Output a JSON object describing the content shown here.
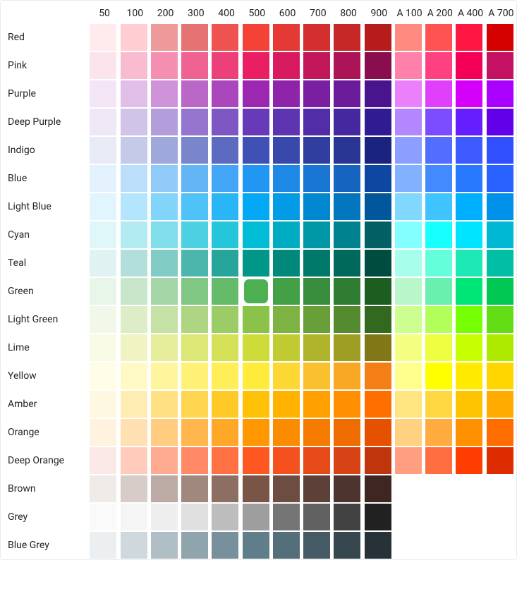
{
  "column_labels": [
    "50",
    "100",
    "200",
    "300",
    "400",
    "500",
    "600",
    "700",
    "800",
    "900",
    "A 100",
    "A 200",
    "A 400",
    "A 700"
  ],
  "row_labels": [
    "Red",
    "Pink",
    "Purple",
    "Deep Purple",
    "Indigo",
    "Blue",
    "Light Blue",
    "Cyan",
    "Teal",
    "Green",
    "Light Green",
    "Lime",
    "Yellow",
    "Amber",
    "Orange",
    "Deep Orange",
    "Brown",
    "Grey",
    "Blue Grey"
  ],
  "selected": {
    "row": 9,
    "col": 5
  },
  "palette": {
    "Red": {
      "50": "#ffebee",
      "100": "#ffcdd2",
      "200": "#ef9a9a",
      "300": "#e57373",
      "400": "#ef5350",
      "500": "#f44336",
      "600": "#e53935",
      "700": "#d32f2f",
      "800": "#c62828",
      "900": "#b71c1c",
      "A 100": "#ff8a80",
      "A 200": "#ff5252",
      "A 400": "#ff1744",
      "A 700": "#d50000"
    },
    "Pink": {
      "50": "#fce4ec",
      "100": "#f8bbd0",
      "200": "#f48fb1",
      "300": "#f06292",
      "400": "#ec407a",
      "500": "#e91e63",
      "600": "#d81b60",
      "700": "#c2185b",
      "800": "#ad1457",
      "900": "#880e4f",
      "A 100": "#ff80ab",
      "A 200": "#ff4081",
      "A 400": "#f50057",
      "A 700": "#c51162"
    },
    "Purple": {
      "50": "#f3e5f5",
      "100": "#e1bee7",
      "200": "#ce93d8",
      "300": "#ba68c8",
      "400": "#ab47bc",
      "500": "#9c27b0",
      "600": "#8e24aa",
      "700": "#7b1fa2",
      "800": "#6a1b9a",
      "900": "#4a148c",
      "A 100": "#ea80fc",
      "A 200": "#e040fb",
      "A 400": "#d500f9",
      "A 700": "#aa00ff"
    },
    "Deep Purple": {
      "50": "#ede7f6",
      "100": "#d1c4e9",
      "200": "#b39ddb",
      "300": "#9575cd",
      "400": "#7e57c2",
      "500": "#673ab7",
      "600": "#5e35b1",
      "700": "#512da8",
      "800": "#4527a0",
      "900": "#311b92",
      "A 100": "#b388ff",
      "A 200": "#7c4dff",
      "A 400": "#651fff",
      "A 700": "#6200ea"
    },
    "Indigo": {
      "50": "#e8eaf6",
      "100": "#c5cae9",
      "200": "#9fa8da",
      "300": "#7986cb",
      "400": "#5c6bc0",
      "500": "#3f51b5",
      "600": "#3949ab",
      "700": "#303f9f",
      "800": "#283593",
      "900": "#1a237e",
      "A 100": "#8c9eff",
      "A 200": "#536dfe",
      "A 400": "#3d5afe",
      "A 700": "#304ffe"
    },
    "Blue": {
      "50": "#e3f2fd",
      "100": "#bbdefb",
      "200": "#90caf9",
      "300": "#64b5f6",
      "400": "#42a5f5",
      "500": "#2196f3",
      "600": "#1e88e5",
      "700": "#1976d2",
      "800": "#1565c0",
      "900": "#0d47a1",
      "A 100": "#82b1ff",
      "A 200": "#448aff",
      "A 400": "#2979ff",
      "A 700": "#2962ff"
    },
    "Light Blue": {
      "50": "#e1f5fe",
      "100": "#b3e5fc",
      "200": "#81d4fa",
      "300": "#4fc3f7",
      "400": "#29b6f6",
      "500": "#03a9f4",
      "600": "#039be5",
      "700": "#0288d1",
      "800": "#0277bd",
      "900": "#01579b",
      "A 100": "#80d8ff",
      "A 200": "#40c4ff",
      "A 400": "#00b0ff",
      "A 700": "#0091ea"
    },
    "Cyan": {
      "50": "#e0f7fa",
      "100": "#b2ebf2",
      "200": "#80deea",
      "300": "#4dd0e1",
      "400": "#26c6da",
      "500": "#00bcd4",
      "600": "#00acc1",
      "700": "#0097a7",
      "800": "#00838f",
      "900": "#006064",
      "A 100": "#84ffff",
      "A 200": "#18ffff",
      "A 400": "#00e5ff",
      "A 700": "#00b8d4"
    },
    "Teal": {
      "50": "#e0f2f1",
      "100": "#b2dfdb",
      "200": "#80cbc4",
      "300": "#4db6ac",
      "400": "#26a69a",
      "500": "#009688",
      "600": "#00897b",
      "700": "#00796b",
      "800": "#00695c",
      "900": "#004d40",
      "A 100": "#a7ffeb",
      "A 200": "#64ffda",
      "A 400": "#1de9b6",
      "A 700": "#00bfa5"
    },
    "Green": {
      "50": "#e8f5e9",
      "100": "#c8e6c9",
      "200": "#a5d6a7",
      "300": "#81c784",
      "400": "#66bb6a",
      "500": "#4caf50",
      "600": "#43a047",
      "700": "#388e3c",
      "800": "#2e7d32",
      "900": "#1b5e20",
      "A 100": "#b9f6ca",
      "A 200": "#69f0ae",
      "A 400": "#00e676",
      "A 700": "#00c853"
    },
    "Light Green": {
      "50": "#f1f8e9",
      "100": "#dcedc8",
      "200": "#c5e1a5",
      "300": "#aed581",
      "400": "#9ccc65",
      "500": "#8bc34a",
      "600": "#7cb342",
      "700": "#689f38",
      "800": "#558b2f",
      "900": "#33691e",
      "A 100": "#ccff90",
      "A 200": "#b2ff59",
      "A 400": "#76ff03",
      "A 700": "#64dd17"
    },
    "Lime": {
      "50": "#f9fbe7",
      "100": "#f0f4c3",
      "200": "#e6ee9c",
      "300": "#dce775",
      "400": "#d4e157",
      "500": "#cddc39",
      "600": "#c0ca33",
      "700": "#afb42b",
      "800": "#9e9d24",
      "900": "#827717",
      "A 100": "#f4ff81",
      "A 200": "#eeff41",
      "A 400": "#c6ff00",
      "A 700": "#aeea00"
    },
    "Yellow": {
      "50": "#fffde7",
      "100": "#fff9c4",
      "200": "#fff59d",
      "300": "#fff176",
      "400": "#ffee58",
      "500": "#ffeb3b",
      "600": "#fdd835",
      "700": "#fbc02d",
      "800": "#f9a825",
      "900": "#f57f17",
      "A 100": "#ffff8d",
      "A 200": "#ffff00",
      "A 400": "#ffea00",
      "A 700": "#ffd600"
    },
    "Amber": {
      "50": "#fff8e1",
      "100": "#ffecb3",
      "200": "#ffe082",
      "300": "#ffd54f",
      "400": "#ffca28",
      "500": "#ffc107",
      "600": "#ffb300",
      "700": "#ffa000",
      "800": "#ff8f00",
      "900": "#ff6f00",
      "A 100": "#ffe57f",
      "A 200": "#ffd740",
      "A 400": "#ffc400",
      "A 700": "#ffab00"
    },
    "Orange": {
      "50": "#fff3e0",
      "100": "#ffe0b2",
      "200": "#ffcc80",
      "300": "#ffb74d",
      "400": "#ffa726",
      "500": "#ff9800",
      "600": "#fb8c00",
      "700": "#f57c00",
      "800": "#ef6c00",
      "900": "#e65100",
      "A 100": "#ffd180",
      "A 200": "#ffab40",
      "A 400": "#ff9100",
      "A 700": "#ff6d00"
    },
    "Deep Orange": {
      "50": "#fbe9e7",
      "100": "#ffccbc",
      "200": "#ffab91",
      "300": "#ff8a65",
      "400": "#ff7043",
      "500": "#ff5722",
      "600": "#f4511e",
      "700": "#e64a19",
      "800": "#d84315",
      "900": "#bf360c",
      "A 100": "#ff9e80",
      "A 200": "#ff6e40",
      "A 400": "#ff3d00",
      "A 700": "#dd2c00"
    },
    "Brown": {
      "50": "#efebe9",
      "100": "#d7ccc8",
      "200": "#bcaaa4",
      "300": "#a1887f",
      "400": "#8d6e63",
      "500": "#795548",
      "600": "#6d4c41",
      "700": "#5d4037",
      "800": "#4e342e",
      "900": "#3e2723"
    },
    "Grey": {
      "50": "#fafafa",
      "100": "#f5f5f5",
      "200": "#eeeeee",
      "300": "#e0e0e0",
      "400": "#bdbdbd",
      "500": "#9e9e9e",
      "600": "#757575",
      "700": "#616161",
      "800": "#424242",
      "900": "#212121"
    },
    "Blue Grey": {
      "50": "#eceff1",
      "100": "#cfd8dc",
      "200": "#b0bec5",
      "300": "#90a4ae",
      "400": "#78909c",
      "500": "#607d8b",
      "600": "#546e7a",
      "700": "#455a64",
      "800": "#37474f",
      "900": "#263238"
    }
  }
}
